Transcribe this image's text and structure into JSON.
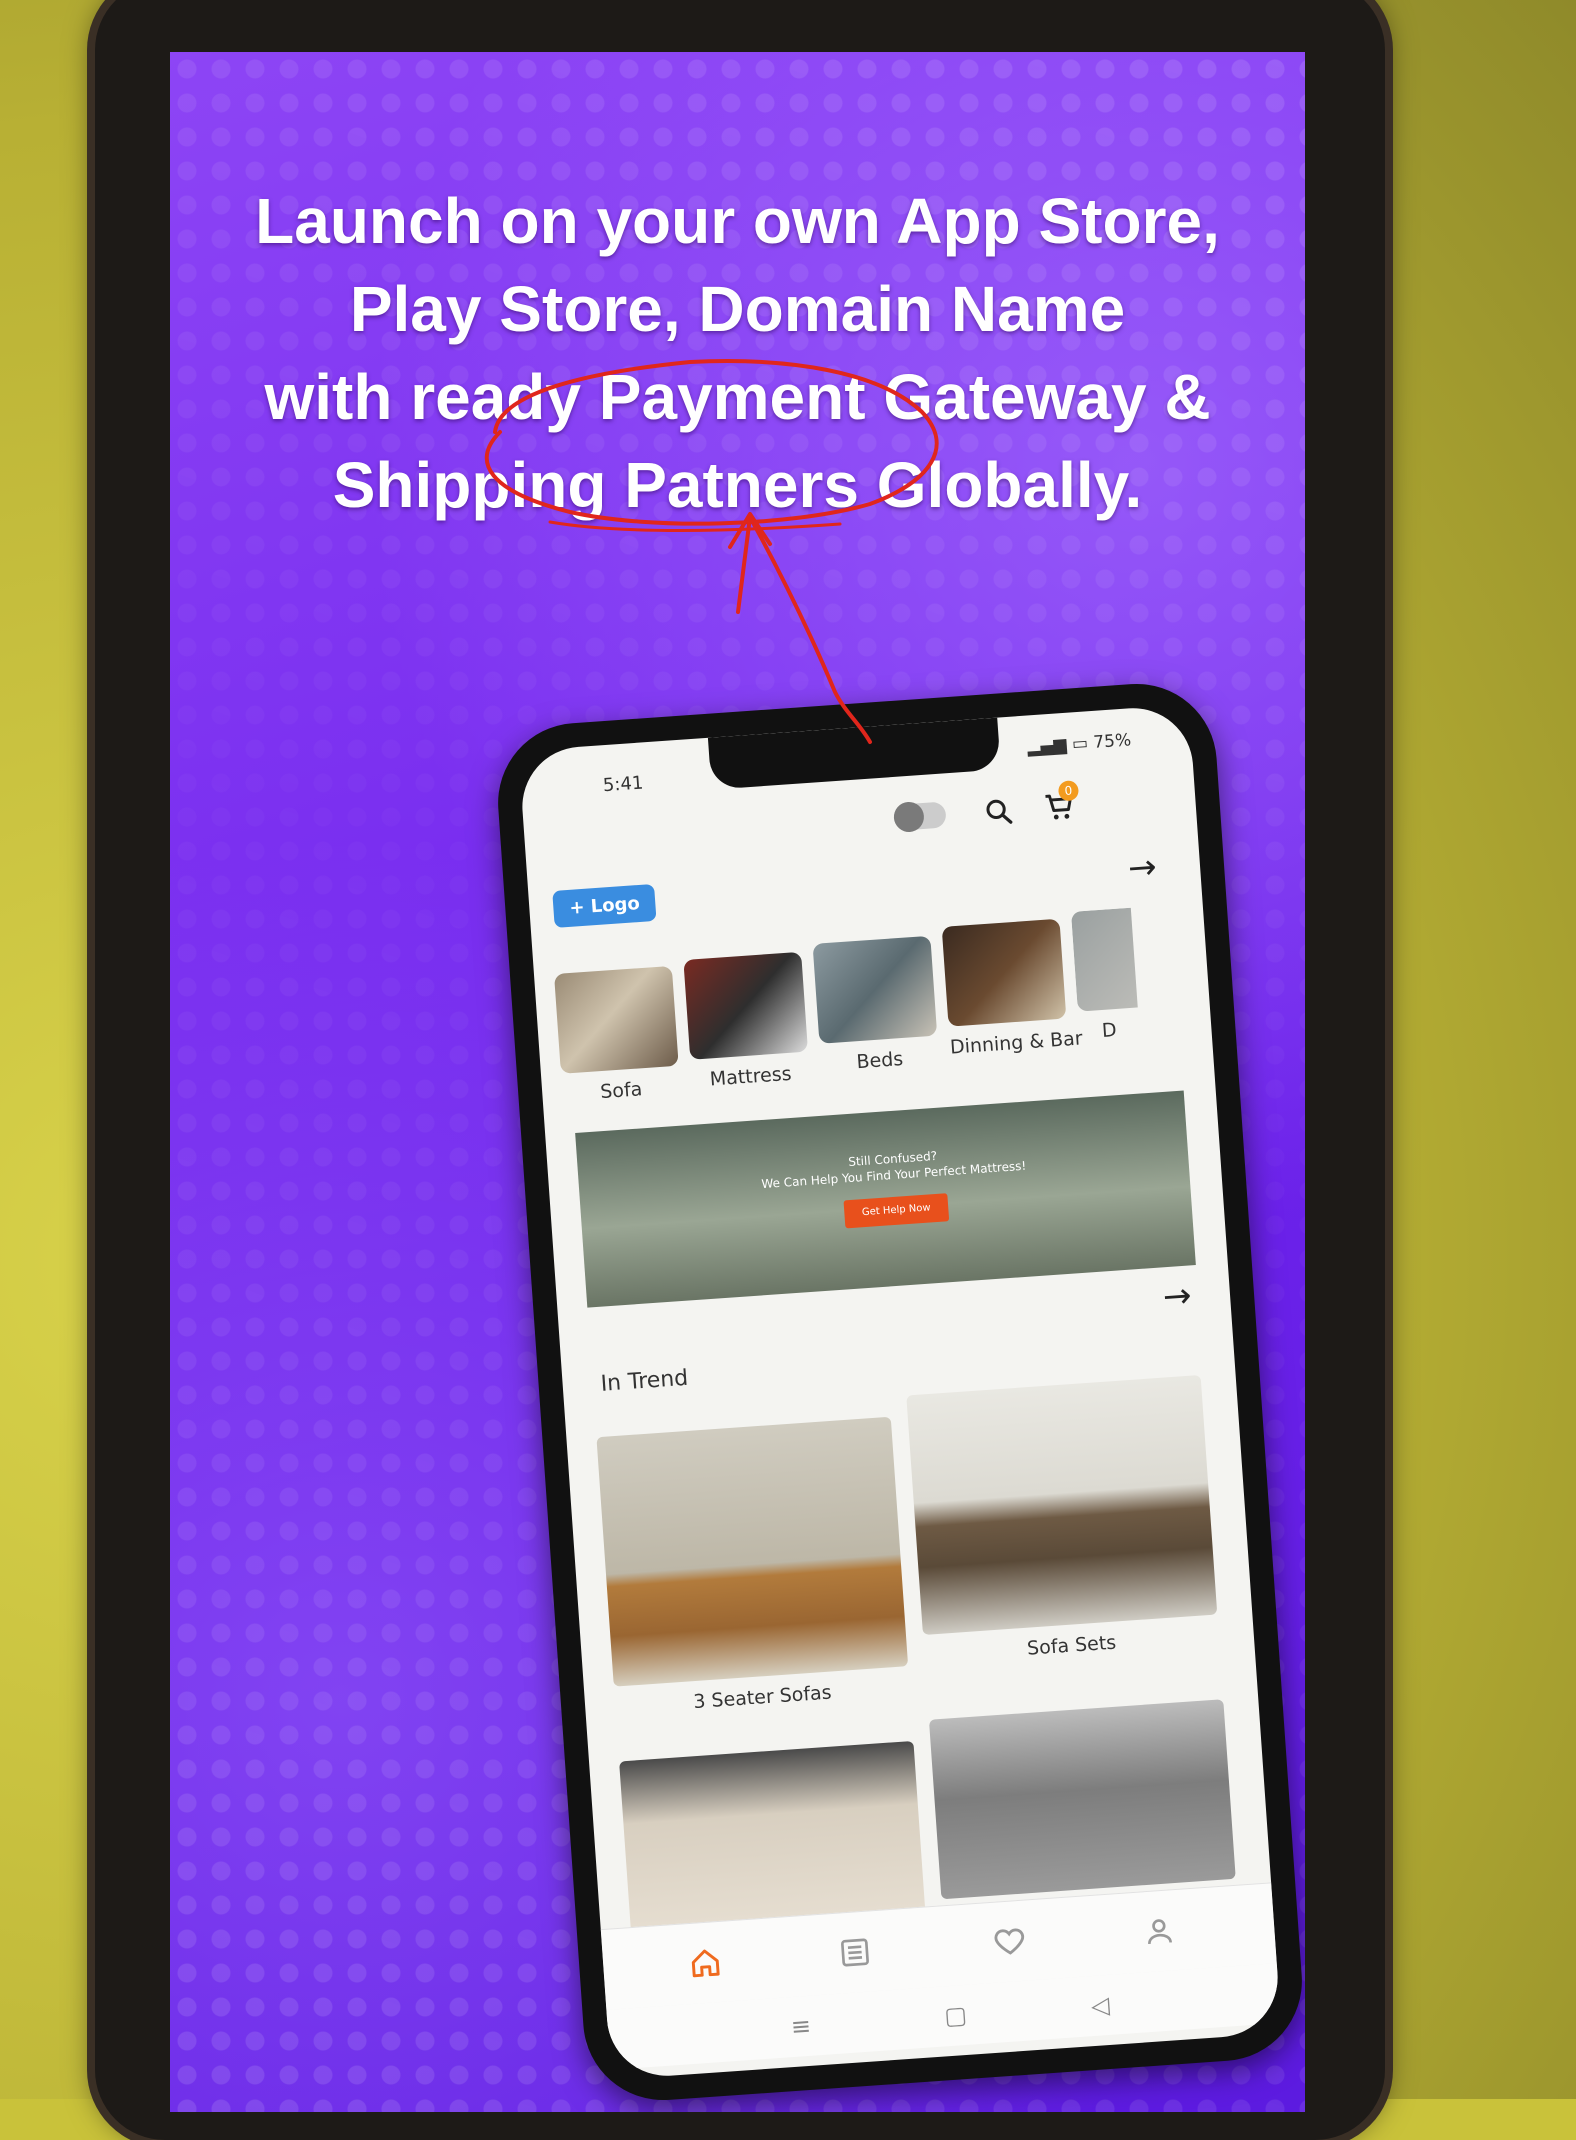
{
  "headline": {
    "line1": "Launch on your own App Store,",
    "line2": "Play Store, Domain Name",
    "line3": "with ready Payment Gateway &",
    "line4": "Shipping Patners Globally."
  },
  "mockup": {
    "status": {
      "time": "5:41",
      "battery": "75%"
    },
    "header": {
      "logo_label": "+ Logo",
      "cart_count": "0"
    },
    "categories": [
      {
        "label": "Sofa"
      },
      {
        "label": "Mattress"
      },
      {
        "label": "Beds"
      },
      {
        "label": "Dinning & Bar"
      },
      {
        "label": "D"
      }
    ],
    "banner": {
      "line1": "Still Confused?",
      "line2": "We Can Help You Find Your Perfect Mattress!",
      "button": "Get Help Now"
    },
    "trend": {
      "title": "In Trend",
      "items": [
        {
          "label": "3 Seater Sofas"
        },
        {
          "label": "Sofa Sets"
        },
        {
          "label": ""
        },
        {
          "label": ""
        }
      ]
    }
  },
  "colors": {
    "screen_purple": "#7a2ff0",
    "accent_orange": "#f39b1f",
    "annotation_red": "#e0261c",
    "logo_blue": "#3a8de0"
  }
}
